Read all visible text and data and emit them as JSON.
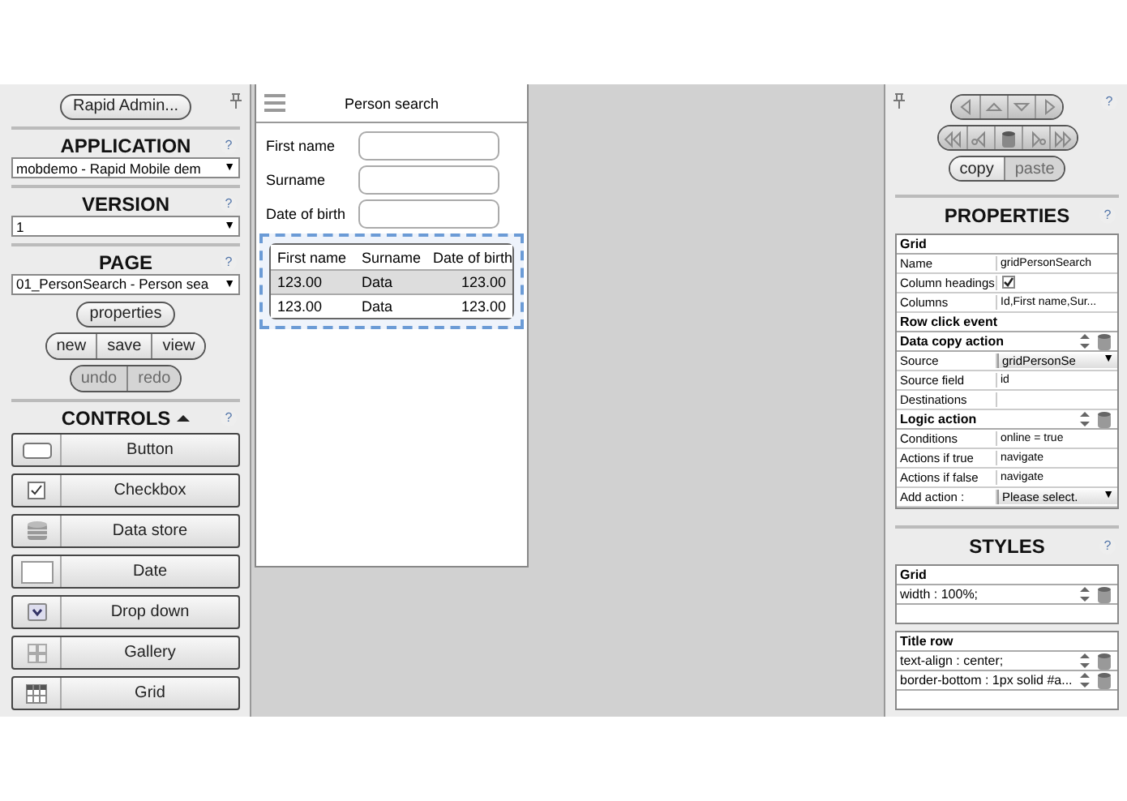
{
  "left_panel": {
    "admin_button": "Rapid Admin...",
    "sections": [
      {
        "title": "APPLICATION",
        "help": "?",
        "value": "mobdemo - Rapid Mobile dem",
        "caret": "▼"
      },
      {
        "title": "VERSION",
        "help": "?",
        "value": "1",
        "caret": "▼"
      },
      {
        "title": "PAGE",
        "help": "?",
        "value": "01_PersonSearch - Person sea",
        "caret": "▼"
      }
    ],
    "properties_button": "properties",
    "page_buttons": [
      {
        "label": "new",
        "disabled": false
      },
      {
        "label": "save",
        "disabled": false
      },
      {
        "label": "view",
        "disabled": false
      }
    ],
    "history_buttons": [
      {
        "label": "undo",
        "disabled": true
      },
      {
        "label": "redo",
        "disabled": true
      }
    ],
    "controls": {
      "title": "CONTROLS",
      "expanded": true,
      "help": "?",
      "items": [
        {
          "kind": "button",
          "label": "Button"
        },
        {
          "kind": "checkbox",
          "label": "Checkbox"
        },
        {
          "kind": "datastore",
          "label": "Data store"
        },
        {
          "kind": "date",
          "label": "Date"
        },
        {
          "kind": "dropdown",
          "label": "Drop down"
        },
        {
          "kind": "gallery",
          "label": "Gallery"
        },
        {
          "kind": "grid",
          "label": "Grid"
        }
      ]
    }
  },
  "page_preview": {
    "title": "Person search",
    "fields": [
      {
        "label": "First name"
      },
      {
        "label": "Surname"
      },
      {
        "label": "Date of birth"
      }
    ],
    "grid": {
      "selected": true,
      "columns": [
        "First name",
        "Surname",
        "Date of birth"
      ],
      "rows": [
        {
          "selected": true,
          "cells": [
            "123.00",
            "Data",
            "123.00"
          ]
        },
        {
          "selected": false,
          "cells": [
            "123.00",
            "Data",
            "123.00"
          ]
        }
      ]
    }
  },
  "right_panel": {
    "help": "?",
    "nav_rows": [
      [
        {
          "kind": "left",
          "disabled": false
        },
        {
          "kind": "up",
          "disabled": false
        },
        {
          "kind": "down",
          "disabled": false
        },
        {
          "kind": "right",
          "disabled": false
        }
      ],
      [
        {
          "kind": "first",
          "disabled": false
        },
        {
          "kind": "previous",
          "disabled": false
        },
        {
          "kind": "delete",
          "disabled": false
        },
        {
          "kind": "next",
          "disabled": false
        },
        {
          "kind": "last",
          "disabled": false
        }
      ]
    ],
    "clipboard_buttons": [
      {
        "label": "copy",
        "disabled": false
      },
      {
        "label": "paste",
        "disabled": true
      }
    ],
    "properties": {
      "title": "PROPERTIES",
      "help": "?",
      "groups": [
        {
          "title": "Grid",
          "actions": false,
          "rows": [
            {
              "kind": "text",
              "label": "Name",
              "value": "gridPersonSearch"
            },
            {
              "kind": "checkbox",
              "label": "Column headings",
              "checked": true
            },
            {
              "kind": "text",
              "label": "Columns",
              "value": "Id,First name,Sur..."
            }
          ]
        },
        {
          "title": "Row click event",
          "actions": false
        },
        {
          "title": "Data copy action",
          "actions": true,
          "rows": [
            {
              "kind": "select",
              "label": "Source",
              "value": "gridPersonSe",
              "caret": "▼"
            },
            {
              "kind": "text",
              "label": "Source field",
              "value": "id"
            },
            {
              "kind": "text",
              "label": "Destinations"
            }
          ]
        },
        {
          "title": "Logic action",
          "actions": true,
          "rows": [
            {
              "kind": "text",
              "label": "Conditions",
              "value": "online = true"
            },
            {
              "kind": "text",
              "label": "Actions if true",
              "value": "navigate"
            },
            {
              "kind": "text",
              "label": "Actions if false",
              "value": "navigate"
            },
            {
              "kind": "select",
              "label": "Add action :",
              "value": "Please select.",
              "caret": "▼"
            }
          ]
        }
      ]
    },
    "styles": {
      "title": "STYLES",
      "help": "?",
      "groups": [
        {
          "title": "Grid",
          "rules": [
            "width  :  100%;"
          ]
        },
        {
          "title": "Title row",
          "rules": [
            "text-align  :  center;",
            "border-bottom  :  1px solid #a..."
          ]
        }
      ]
    }
  }
}
